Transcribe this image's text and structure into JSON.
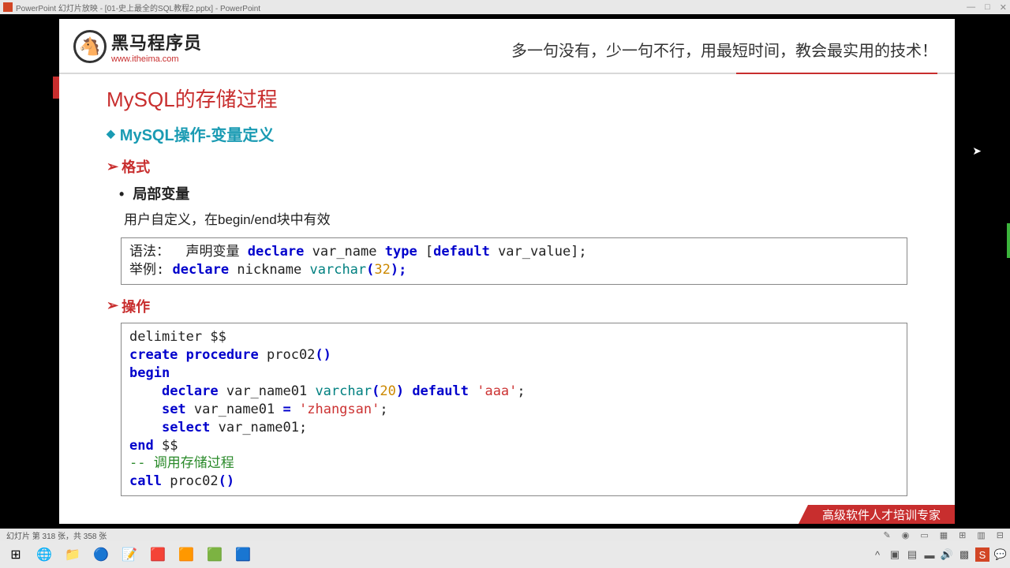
{
  "titlebar": {
    "app": "PowerPoint 幻灯片放映 - [01-史上最全的SQL教程2.pptx] - PowerPoint"
  },
  "logo": {
    "cn": "黑马程序员",
    "url": "www.itheima.com",
    "tagline": "多一句没有，少一句不行，用最短时间，教会最实用的技术！"
  },
  "slide": {
    "title": "MySQL的存储过程",
    "subtitle": "MySQL操作-变量定义",
    "section1": "格式",
    "bullet1": "局部变量",
    "desc1": "用户自定义，在begin/end块中有效",
    "code1": {
      "l1a": "语法：  声明变量 ",
      "l1b": "declare",
      "l1c": " var_name ",
      "l1d": "type",
      "l1e": " [",
      "l1f": "default",
      "l1g": " var_value];",
      "l2a": "举例: ",
      "l2b": "declare",
      "l2c": " nickname ",
      "l2d": "varchar",
      "l2e": "(",
      "l2f": "32",
      "l2g": ");"
    },
    "section2": "操作",
    "code2": {
      "l1": "delimiter $$",
      "l2a": "create procedure",
      "l2b": " proc02",
      "l2c": "()",
      "l3": "begin",
      "l4a": "    ",
      "l4b": "declare",
      "l4c": " var_name01 ",
      "l4d": "varchar",
      "l4e": "(",
      "l4f": "20",
      "l4g": ") ",
      "l4h": "default",
      "l4i": " ",
      "l4j": "'aaa'",
      "l4k": ";",
      "l5a": "    ",
      "l5b": "set",
      "l5c": " var_name01 ",
      "l5d": "=",
      "l5e": " ",
      "l5f": "'zhangsan'",
      "l5g": ";",
      "l6a": "    ",
      "l6b": "select",
      "l6c": " var_name01;",
      "l7a": "end",
      "l7b": " $$",
      "l8": "-- 调用存储过程",
      "l9a": "call",
      "l9b": " proc02",
      "l9c": "()"
    },
    "footer_ribbon": "高级软件人才培训专家"
  },
  "status": {
    "left": "幻灯片 第 318 张，共 358 张"
  }
}
